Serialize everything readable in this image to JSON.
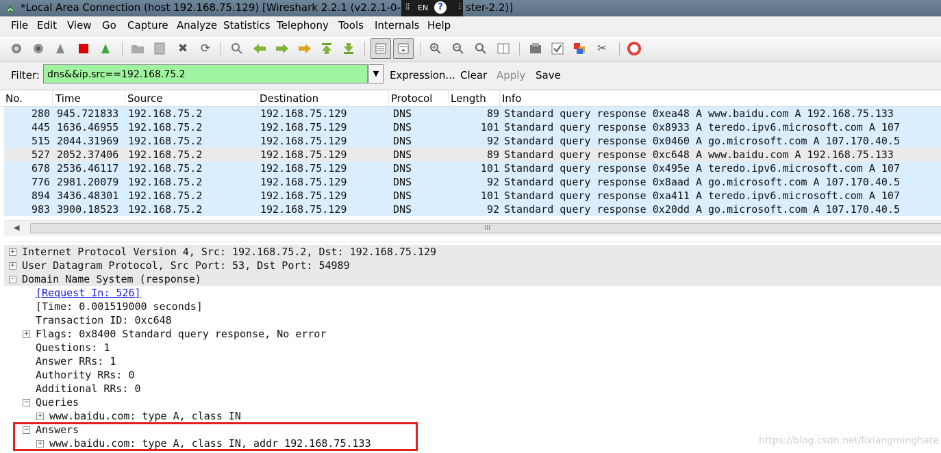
{
  "window": {
    "title": "*Local Area Connection (host 192.168.75.129) [Wireshark 2.2.1 (v2.2.1-0-ga6fbe",
    "title_suffix": "ster-2.2)]",
    "ime_label": "EN"
  },
  "menu": [
    "File",
    "Edit",
    "View",
    "Go",
    "Capture",
    "Analyze",
    "Statistics",
    "Telephony",
    "Tools",
    "Internals",
    "Help"
  ],
  "filter": {
    "label": "Filter:",
    "value": "dns&&ip.src==192.168.75.2",
    "expression": "Expression...",
    "clear": "Clear",
    "apply": "Apply",
    "save": "Save"
  },
  "packet_list": {
    "columns": [
      "No.",
      "Time",
      "Source",
      "Destination",
      "Protocol",
      "Length",
      "Info"
    ],
    "rows": [
      {
        "no": "280",
        "time": "945.721833",
        "src": "192.168.75.2",
        "dst": "192.168.75.129",
        "proto": "DNS",
        "len": "89",
        "info": "Standard query response 0xea48 A www.baidu.com A 192.168.75.133"
      },
      {
        "no": "445",
        "time": "1636.46955",
        "src": "192.168.75.2",
        "dst": "192.168.75.129",
        "proto": "DNS",
        "len": "101",
        "info": "Standard query response 0x8933 A teredo.ipv6.microsoft.com A 107"
      },
      {
        "no": "515",
        "time": "2044.31969",
        "src": "192.168.75.2",
        "dst": "192.168.75.129",
        "proto": "DNS",
        "len": "92",
        "info": "Standard query response 0x0460 A go.microsoft.com A 107.170.40.5"
      },
      {
        "no": "527",
        "time": "2052.37406",
        "src": "192.168.75.2",
        "dst": "192.168.75.129",
        "proto": "DNS",
        "len": "89",
        "info": "Standard query response 0xc648 A www.baidu.com A 192.168.75.133"
      },
      {
        "no": "678",
        "time": "2536.46117",
        "src": "192.168.75.2",
        "dst": "192.168.75.129",
        "proto": "DNS",
        "len": "101",
        "info": "Standard query response 0x495e A teredo.ipv6.microsoft.com A 107"
      },
      {
        "no": "776",
        "time": "2981.20079",
        "src": "192.168.75.2",
        "dst": "192.168.75.129",
        "proto": "DNS",
        "len": "92",
        "info": "Standard query response 0x8aad A go.microsoft.com A 107.170.40.5"
      },
      {
        "no": "894",
        "time": "3436.48301",
        "src": "192.168.75.2",
        "dst": "192.168.75.129",
        "proto": "DNS",
        "len": "101",
        "info": "Standard query response 0xa411 A teredo.ipv6.microsoft.com A 107"
      },
      {
        "no": "983",
        "time": "3900.18523",
        "src": "192.168.75.2",
        "dst": "192.168.75.129",
        "proto": "DNS",
        "len": "92",
        "info": "Standard query response 0x20dd A go.microsoft.com A 107.170.40.5"
      }
    ]
  },
  "details": {
    "ip": "Internet Protocol Version 4, Src: 192.168.75.2, Dst: 192.168.75.129",
    "udp": "User Datagram Protocol, Src Port: 53, Dst Port: 54989",
    "dns": "Domain Name System (response)",
    "request_in": "[Request In: 526]",
    "time": "[Time: 0.001519000 seconds]",
    "transaction": "Transaction ID: 0xc648",
    "flags": "Flags: 0x8400 Standard query response, No error",
    "questions": "Questions: 1",
    "answer_rrs": "Answer RRs: 1",
    "authority_rrs": "Authority RRs: 0",
    "additional_rrs": "Additional RRs: 0",
    "queries": "Queries",
    "query_entry": "www.baidu.com: type A, class IN",
    "answers": "Answers",
    "answer_entry": "www.baidu.com: type A, class IN, addr 192.168.75.133"
  },
  "scroll_mark": "III",
  "watermark": "https://blog.csdn.net/lixiangminghate",
  "colors": {
    "filter_valid": "#a0f3a0",
    "row_bg": "#daeefe",
    "row_selected": "#eaeaea",
    "highlight_box": "#e02020"
  },
  "icons": [
    "interfaces-icon",
    "options-icon",
    "start-capture-icon",
    "stop-capture-icon",
    "restart-capture-icon",
    "open-file-icon",
    "save-file-icon",
    "close-file-icon",
    "reload-icon",
    "find-icon",
    "back-icon",
    "forward-icon",
    "goto-icon",
    "first-packet-icon",
    "last-packet-icon",
    "colorize-icon",
    "autoscroll-icon",
    "zoom-in-icon",
    "zoom-out-icon",
    "zoom-normal-icon",
    "resize-columns-icon",
    "capture-filters-icon",
    "display-filters-icon",
    "coloring-rules-icon",
    "preferences-icon",
    "help-icon"
  ]
}
